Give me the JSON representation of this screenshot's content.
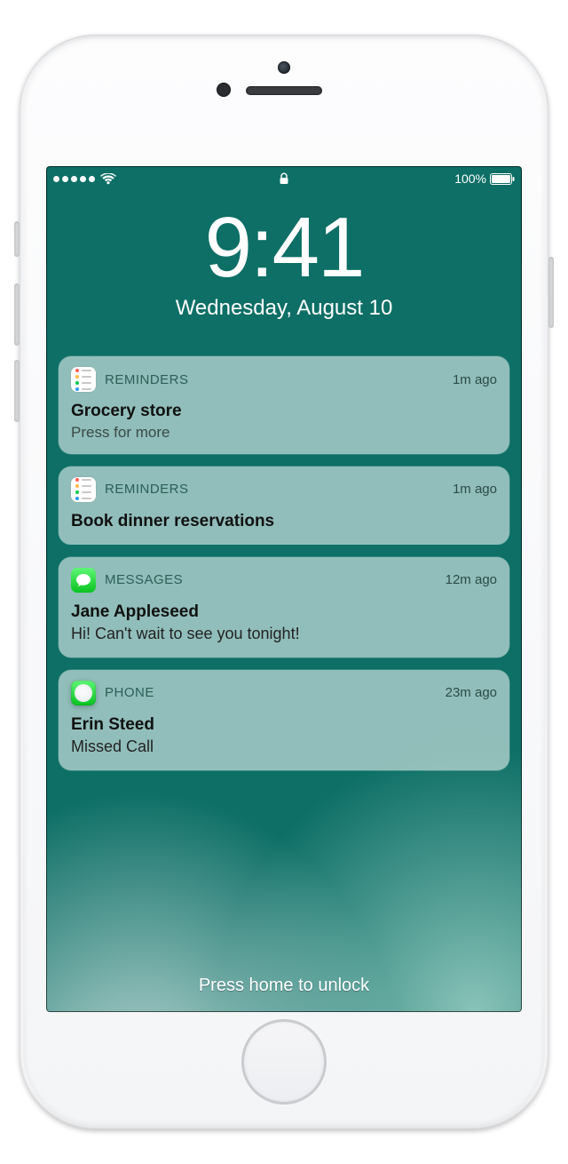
{
  "status": {
    "signal_dots": 5,
    "battery_text": "100%"
  },
  "clock": {
    "time": "9:41",
    "date": "Wednesday, August 10"
  },
  "notifications": [
    {
      "app": "REMINDERS",
      "icon": "reminders",
      "time": "1m ago",
      "title": "Grocery store",
      "body": "",
      "hint": "Press for more"
    },
    {
      "app": "REMINDERS",
      "icon": "reminders",
      "time": "1m ago",
      "title": "Book dinner reservations",
      "body": "",
      "hint": ""
    },
    {
      "app": "MESSAGES",
      "icon": "messages",
      "time": "12m ago",
      "title": "Jane Appleseed",
      "body": "Hi! Can't wait to see you tonight!",
      "hint": ""
    },
    {
      "app": "PHONE",
      "icon": "phone",
      "time": "23m ago",
      "title": "Erin Steed",
      "body": "Missed Call",
      "hint": ""
    }
  ],
  "unlock_hint": "Press home to unlock"
}
